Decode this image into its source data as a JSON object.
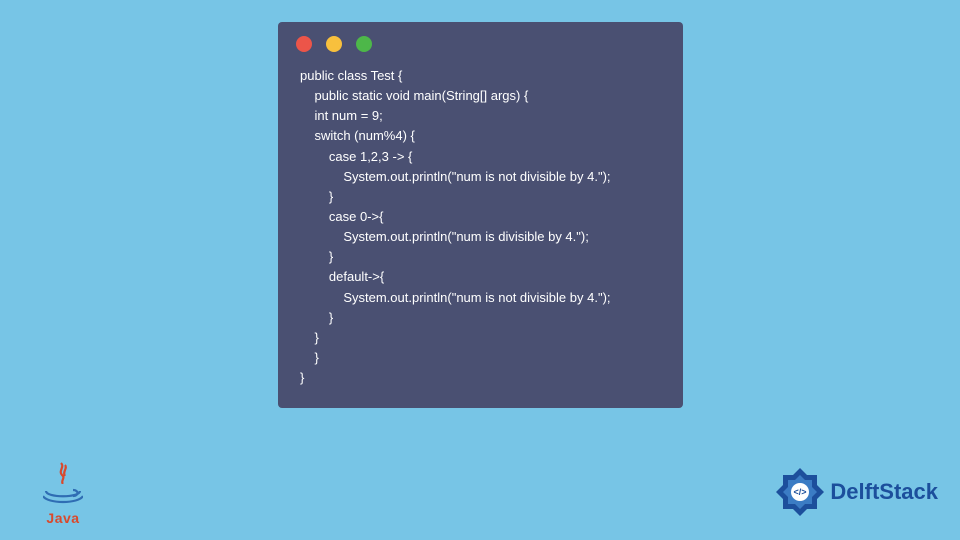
{
  "window": {
    "dots": [
      "red",
      "yellow",
      "green"
    ]
  },
  "code": {
    "lines": [
      "public class Test {",
      "    public static void main(String[] args) {",
      "    int num = 9;",
      "    switch (num%4) {",
      "        case 1,2,3 -> {",
      "            System.out.println(\"num is not divisible by 4.\");",
      "        }",
      "        case 0->{",
      "            System.out.println(\"num is divisible by 4.\");",
      "        }",
      "        default->{",
      "            System.out.println(\"num is not divisible by 4.\");",
      "        }",
      "    }",
      "    }",
      "}"
    ]
  },
  "logos": {
    "java_label": "Java",
    "delft_label": "DelftStack"
  },
  "colors": {
    "page_bg": "#77c5e6",
    "window_bg": "#4a5072",
    "code_text": "#ffffff",
    "dot_red": "#ec5549",
    "dot_yellow": "#f8c03d",
    "dot_green": "#4db749",
    "java_accent": "#d9492c",
    "java_blue": "#2f6db3",
    "delft_blue": "#1c4f9c"
  }
}
